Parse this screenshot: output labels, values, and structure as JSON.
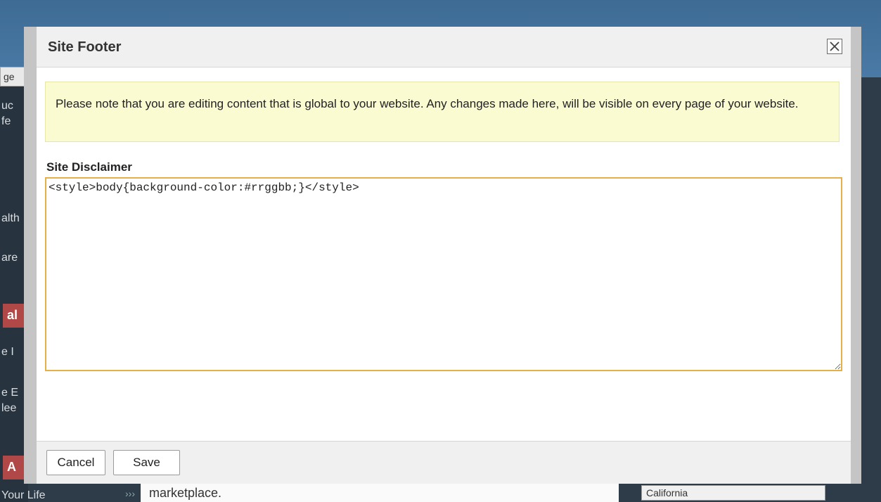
{
  "background": {
    "search_fragment": "ge",
    "left_fragments": [
      "uc",
      "fe",
      "alth",
      "are",
      "e I",
      "e E",
      "lee"
    ],
    "red_tabs": [
      "al",
      "A"
    ],
    "bottom_text": "marketplace.",
    "bottom_left_text": "Your Life",
    "state_select_value": "California"
  },
  "modal": {
    "title": "Site Footer",
    "close_icon": "close-icon",
    "notice": "Please note that you are editing content that is global to your website. Any changes made here, will be visible on every page of your website.",
    "field_label": "Site Disclaimer",
    "disclaimer_value": "<style>body{background-color:#rrggbb;}</style>",
    "buttons": {
      "cancel": "Cancel",
      "save": "Save"
    }
  },
  "colors": {
    "notice_bg": "#fbfbd2",
    "textarea_focus_border": "#e6b049"
  }
}
